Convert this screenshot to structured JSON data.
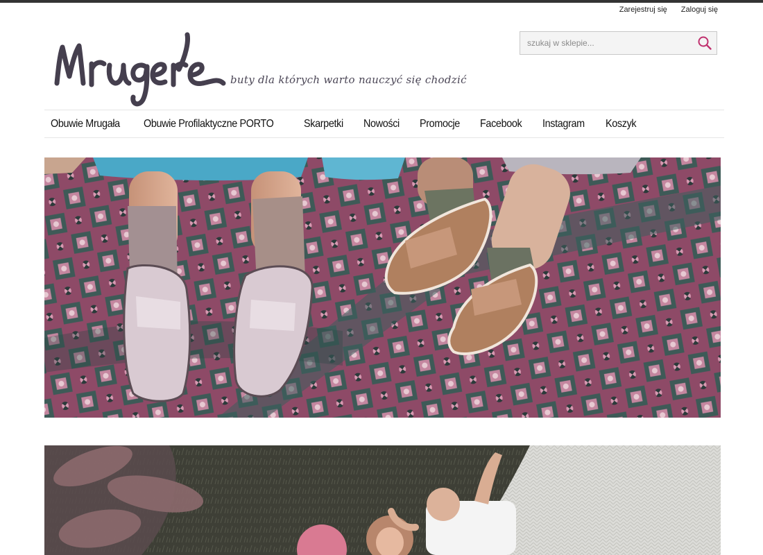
{
  "account": {
    "register_label": "Zarejestruj się",
    "login_label": "Zaloguj się"
  },
  "logo": {
    "wordmark": "Mrugała",
    "tagline": "buty dla których warto nauczyć się chodzić"
  },
  "search": {
    "placeholder": "szukaj w sklepie...",
    "icon": "search-icon",
    "icon_color": "#c0306e"
  },
  "nav": {
    "items": [
      {
        "label": "Obuwie Mrugała"
      },
      {
        "label": "Obuwie Profilaktyczne PORTO"
      },
      {
        "label": "Skarpetki"
      },
      {
        "label": "Nowości"
      },
      {
        "label": "Promocje"
      },
      {
        "label": "Facebook"
      },
      {
        "label": "Instagram"
      },
      {
        "label": "Koszyk"
      }
    ]
  },
  "banners": [
    {
      "subject": "children-shoes-on-rug-photo"
    },
    {
      "subject": "children-playing-on-grass-photo"
    }
  ],
  "colors": {
    "top_rule": "#333333",
    "logo": "#453f4e",
    "accent": "#c0306e"
  }
}
